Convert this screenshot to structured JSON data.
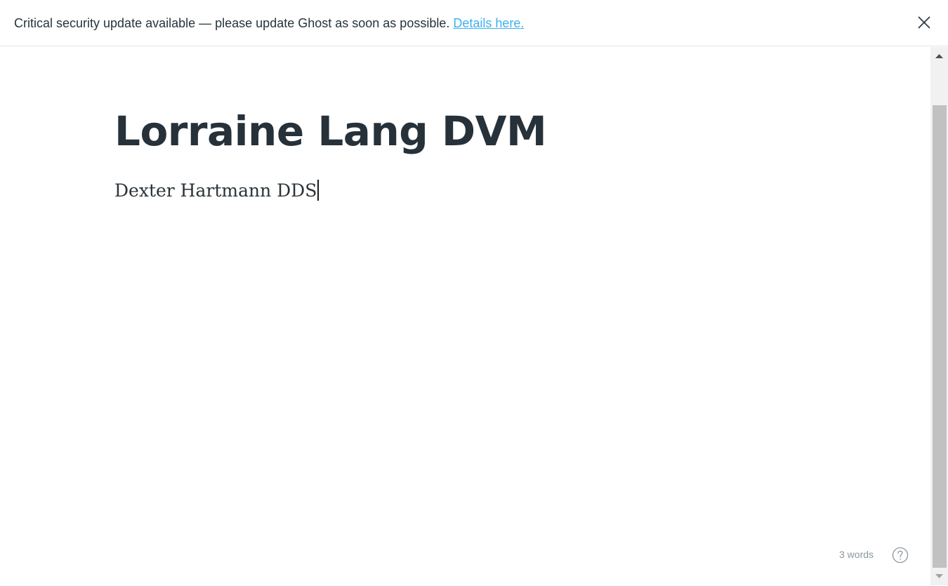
{
  "banner": {
    "message": "Critical security update available — please update Ghost as soon as possible. ",
    "link_text": "Details here.",
    "close_icon": "close-icon"
  },
  "editor": {
    "title": "Lorraine Lang DVM",
    "body": "Dexter Hartmann DDS"
  },
  "footer": {
    "word_count": "3 words",
    "help_icon": "help-circle-icon"
  },
  "scrollbar": {
    "up_icon": "scroll-up-arrow-icon",
    "down_icon": "scroll-down-arrow-icon"
  }
}
